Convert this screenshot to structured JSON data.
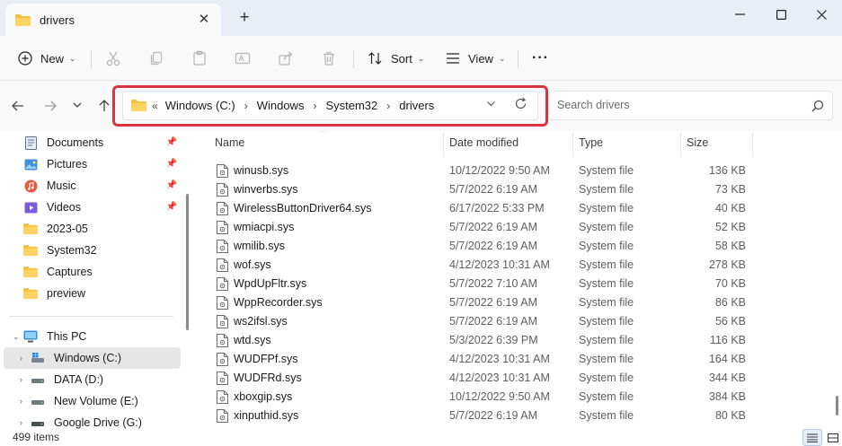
{
  "window": {
    "tab_title": "drivers",
    "new_tab": "+",
    "close_tab": "✕",
    "minimize": "—",
    "maximize": "☐",
    "close": "✕"
  },
  "toolbar": {
    "new_label": "New",
    "sort_label": "Sort",
    "view_label": "View",
    "more_label": "···"
  },
  "address": {
    "overflow": "«",
    "crumbs": [
      "Windows (C:)",
      "Windows",
      "System32",
      "drivers"
    ],
    "separator": "›",
    "search_placeholder": "Search drivers"
  },
  "sidebar": {
    "quick_access": [
      {
        "label": "Documents",
        "icon": "documents-icon"
      },
      {
        "label": "Pictures",
        "icon": "pictures-icon"
      },
      {
        "label": "Music",
        "icon": "music-icon"
      },
      {
        "label": "Videos",
        "icon": "videos-icon"
      },
      {
        "label": "2023-05",
        "icon": "folder-icon"
      },
      {
        "label": "System32",
        "icon": "folder-icon"
      },
      {
        "label": "Captures",
        "icon": "folder-icon"
      },
      {
        "label": "preview",
        "icon": "folder-icon"
      }
    ],
    "this_pc": "This PC",
    "drives": [
      {
        "label": "Windows (C:)",
        "icon": "system-drive-icon",
        "selected": true
      },
      {
        "label": "DATA (D:)",
        "icon": "drive-icon",
        "selected": false
      },
      {
        "label": "New Volume (E:)",
        "icon": "drive-icon",
        "selected": false
      },
      {
        "label": "Google Drive (G:)",
        "icon": "drive-icon",
        "selected": false
      }
    ]
  },
  "columns": {
    "name": "Name",
    "date": "Date modified",
    "type": "Type",
    "size": "Size"
  },
  "files": [
    {
      "name": "winusb.sys",
      "date": "10/12/2022 9:50 AM",
      "type": "System file",
      "size": "136 KB"
    },
    {
      "name": "winverbs.sys",
      "date": "5/7/2022 6:19 AM",
      "type": "System file",
      "size": "73 KB"
    },
    {
      "name": "WirelessButtonDriver64.sys",
      "date": "6/17/2022 5:33 PM",
      "type": "System file",
      "size": "40 KB"
    },
    {
      "name": "wmiacpi.sys",
      "date": "5/7/2022 6:19 AM",
      "type": "System file",
      "size": "52 KB"
    },
    {
      "name": "wmilib.sys",
      "date": "5/7/2022 6:19 AM",
      "type": "System file",
      "size": "58 KB"
    },
    {
      "name": "wof.sys",
      "date": "4/12/2023 10:31 AM",
      "type": "System file",
      "size": "278 KB"
    },
    {
      "name": "WpdUpFltr.sys",
      "date": "5/7/2022 7:10 AM",
      "type": "System file",
      "size": "70 KB"
    },
    {
      "name": "WppRecorder.sys",
      "date": "5/7/2022 6:19 AM",
      "type": "System file",
      "size": "86 KB"
    },
    {
      "name": "ws2ifsl.sys",
      "date": "5/7/2022 6:19 AM",
      "type": "System file",
      "size": "56 KB"
    },
    {
      "name": "wtd.sys",
      "date": "5/3/2022 6:39 PM",
      "type": "System file",
      "size": "116 KB"
    },
    {
      "name": "WUDFPf.sys",
      "date": "4/12/2023 10:31 AM",
      "type": "System file",
      "size": "164 KB"
    },
    {
      "name": "WUDFRd.sys",
      "date": "4/12/2023 10:31 AM",
      "type": "System file",
      "size": "344 KB"
    },
    {
      "name": "xboxgip.sys",
      "date": "10/12/2022 9:50 AM",
      "type": "System file",
      "size": "384 KB"
    },
    {
      "name": "xinputhid.sys",
      "date": "5/7/2022 6:19 AM",
      "type": "System file",
      "size": "80 KB"
    }
  ],
  "status": {
    "item_count": "499 items"
  },
  "colors": {
    "highlight_border": "#d9343f",
    "folder_yellow": "#f5c242",
    "accent": "#0067c0"
  }
}
